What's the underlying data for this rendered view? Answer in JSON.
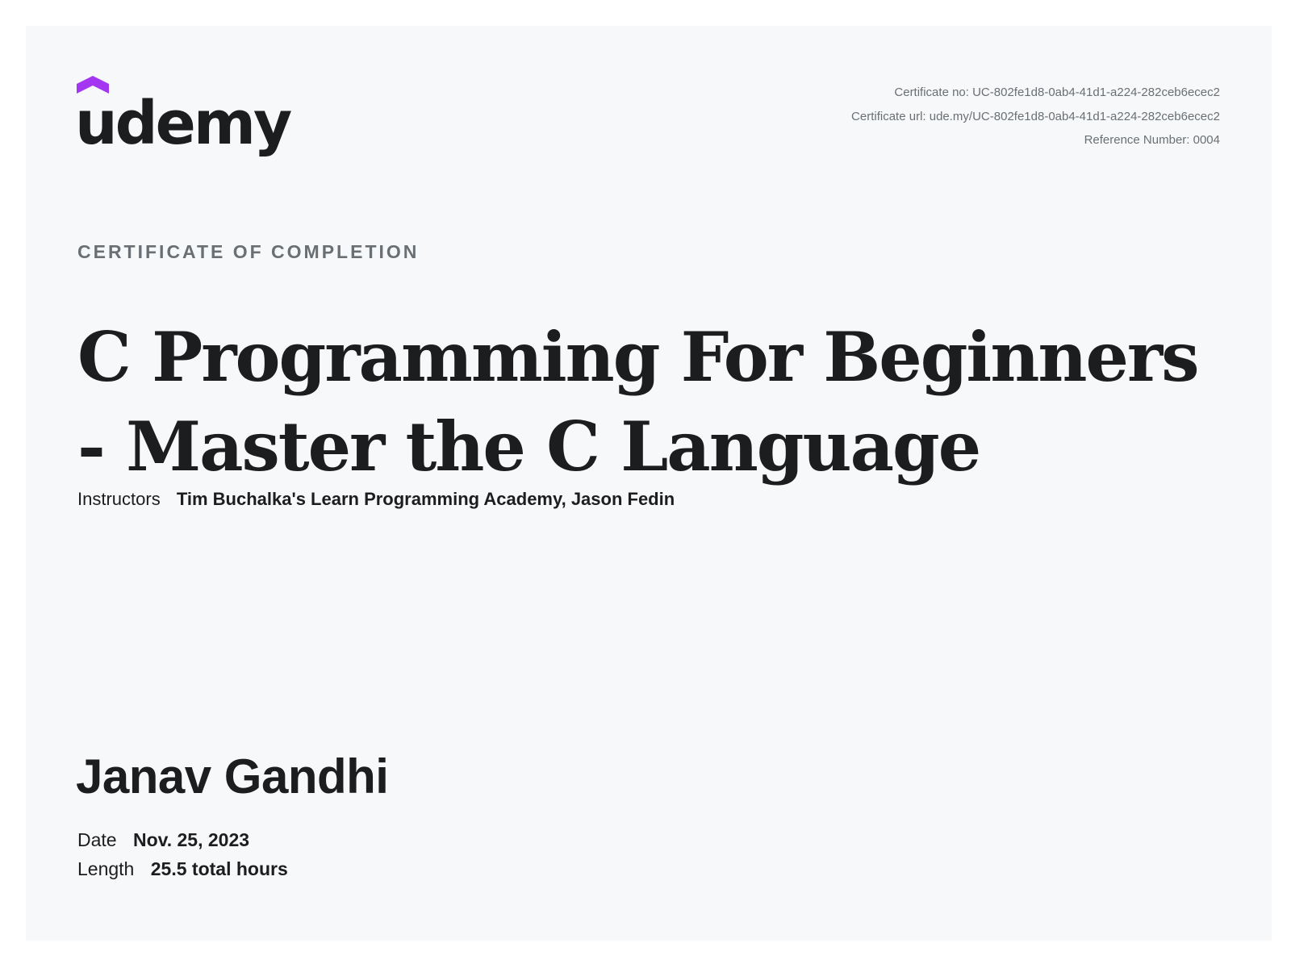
{
  "brand": {
    "name": "udemy",
    "accent_color": "#a435f0",
    "logo_icon": "udemy-cap-icon"
  },
  "certificate": {
    "number": "Certificate no: UC-802fe1d8-0ab4-41d1-a224-282ceb6ecec2",
    "url": "Certificate url: ude.my/UC-802fe1d8-0ab4-41d1-a224-282ceb6ecec2",
    "reference": "Reference Number: 0004",
    "heading": "CERTIFICATE OF COMPLETION"
  },
  "course": {
    "title": "C Programming For Beginners - Master the C Language",
    "instructors_label": "Instructors",
    "instructors": "Tim Buchalka's Learn Programming Academy,  Jason Fedin"
  },
  "recipient": {
    "name": "Janav Gandhi"
  },
  "details": {
    "date_label": "Date",
    "date_value": "Nov. 25, 2023",
    "length_label": "Length",
    "length_value": "25.5 total hours"
  }
}
